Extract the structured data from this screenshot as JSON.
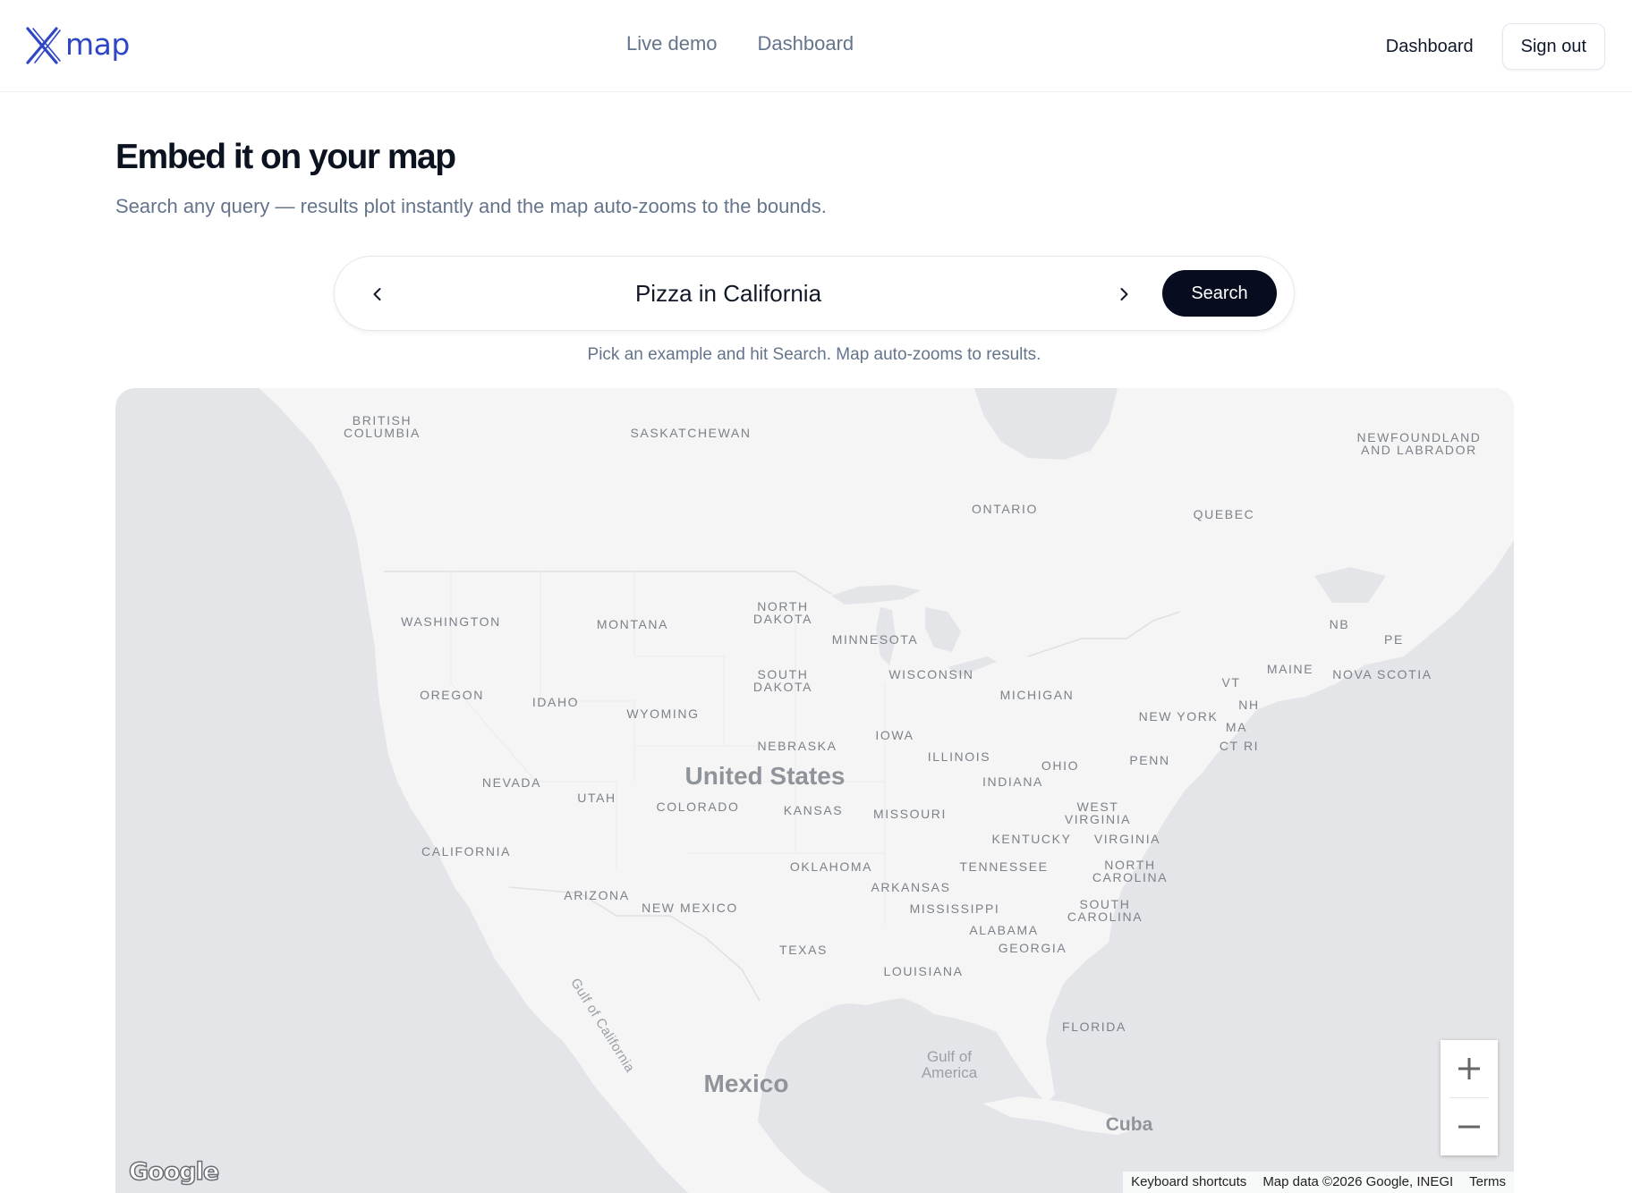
{
  "header": {
    "logo_text": "map",
    "center_nav": [
      "Live demo",
      "Dashboard"
    ],
    "right_nav_link": "Dashboard",
    "sign_out_label": "Sign out"
  },
  "hero": {
    "title": "Embed it on your map",
    "subtitle": "Search any query — results plot instantly and the map auto-zooms to the bounds."
  },
  "search": {
    "query": "Pizza in California",
    "button_label": "Search",
    "hint": "Pick an example and hit Search. Map auto-zooms to results.",
    "prev_icon": "chevron-left-icon",
    "next_icon": "chevron-right-icon"
  },
  "map": {
    "labels": {
      "british_columbia": "BRITISH\nCOLUMBIA",
      "saskatchewan": "SASKATCHEWAN",
      "ontario": "ONTARIO",
      "quebec": "QUEBEC",
      "newfoundland": "NEWFOUNDLAND\nAND LABRADOR",
      "washington": "WASHINGTON",
      "montana": "MONTANA",
      "north_dakota": "NORTH\nDAKOTA",
      "minnesota": "MINNESOTA",
      "south_dakota": "SOUTH\nDAKOTA",
      "wisconsin": "WISCONSIN",
      "michigan": "MICHIGAN",
      "oregon": "OREGON",
      "idaho": "IDAHO",
      "wyoming": "WYOMING",
      "nebraska": "NEBRASKA",
      "iowa": "IOWA",
      "illinois": "ILLINOIS",
      "indiana": "INDIANA",
      "ohio": "OHIO",
      "penn": "PENN",
      "new_york": "NEW YORK",
      "vt": "VT",
      "nh": "NH",
      "ma": "MA",
      "ct_ri": "CT RI",
      "maine": "MAINE",
      "nb": "NB",
      "pe": "PE",
      "nova_scotia": "NOVA SCOTIA",
      "nevada": "NEVADA",
      "utah": "UTAH",
      "colorado": "COLORADO",
      "united_states": "United States",
      "kansas": "KANSAS",
      "missouri": "MISSOURI",
      "west_virginia": "WEST\nVIRGINIA",
      "kentucky": "KENTUCKY",
      "virginia": "VIRGINIA",
      "california": "CALIFORNIA",
      "oklahoma": "OKLAHOMA",
      "tennessee": "TENNESSEE",
      "north_carolina": "NORTH\nCAROLINA",
      "arkansas": "ARKANSAS",
      "arizona": "ARIZONA",
      "new_mexico": "NEW MEXICO",
      "mississippi": "MISSISSIPPI",
      "south_carolina": "SOUTH\nCAROLINA",
      "alabama": "ALABAMA",
      "georgia": "GEORGIA",
      "texas": "TEXAS",
      "louisiana": "LOUISIANA",
      "florida": "FLORIDA",
      "gulf_of_california": "Gulf of California",
      "gulf_of_america": "Gulf of\nAmerica",
      "mexico": "Mexico",
      "cuba": "Cuba"
    },
    "google_logo": "Google",
    "attribution": [
      "Keyboard shortcuts",
      "Map data ©2026 Google, INEGI",
      "Terms"
    ],
    "zoom_in_icon": "plus-icon",
    "zoom_out_icon": "minus-icon",
    "colors": {
      "land": "#f5f5f5",
      "water": "#e4e5e8",
      "border": "#e0e0e0"
    }
  }
}
